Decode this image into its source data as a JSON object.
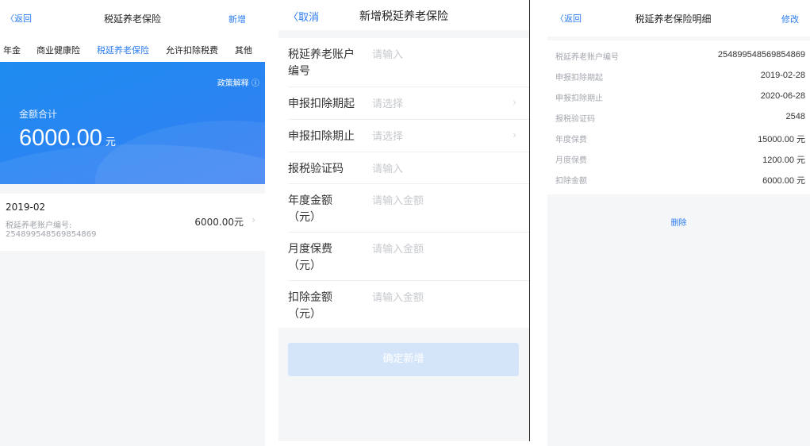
{
  "screen1": {
    "back": "〈返回",
    "title": "税延养老保险",
    "action": "新增",
    "tabs": [
      "年金",
      "商业健康险",
      "税延养老保险",
      "允许扣除税费",
      "其他"
    ],
    "policy": "政策解释 ⓘ",
    "total_label": "金额合计",
    "total_amount": "6000.00",
    "total_unit": "元",
    "record": {
      "date": "2019-02",
      "account_label": "税延养老账户编号:",
      "account_value": "254899548569854869",
      "amount": "6000.00元",
      "chevron": "›"
    }
  },
  "screen2": {
    "cancel": "〈取消",
    "title": "新增税延养老保险",
    "fields": [
      {
        "label": "税延养老账户编号",
        "placeholder": "请输入",
        "arrow": ""
      },
      {
        "label": "申报扣除期起",
        "placeholder": "请选择",
        "arrow": "›"
      },
      {
        "label": "申报扣除期止",
        "placeholder": "请选择",
        "arrow": "›"
      },
      {
        "label": "报税验证码",
        "placeholder": "请输入",
        "arrow": ""
      },
      {
        "label": "年度金额（元）",
        "placeholder": "请输入金额",
        "arrow": ""
      },
      {
        "label": "月度保费（元）",
        "placeholder": "请输入金额",
        "arrow": ""
      },
      {
        "label": "扣除金额（元）",
        "placeholder": "请输入金额",
        "arrow": ""
      }
    ],
    "submit": "确定新增"
  },
  "screen3": {
    "back": "〈返回",
    "title": "税延养老保险明细",
    "action": "修改",
    "rows": [
      {
        "key": "税延养老账户编号",
        "value": "254899548569854869"
      },
      {
        "key": "申报扣除期起",
        "value": "2019-02-28"
      },
      {
        "key": "申报扣除期止",
        "value": "2020-06-28"
      },
      {
        "key": "报税验证码",
        "value": "2548"
      },
      {
        "key": "年度保费",
        "value": "15000.00 元"
      },
      {
        "key": "月度保费",
        "value": "1200.00 元"
      },
      {
        "key": "扣除金额",
        "value": "6000.00 元"
      }
    ],
    "delete": "删除"
  },
  "colors": {
    "accent": "#2a7cf1",
    "banner": "#2a84f2",
    "background": "#f5f6f8",
    "submit_disabled": "#d4e5fa"
  }
}
